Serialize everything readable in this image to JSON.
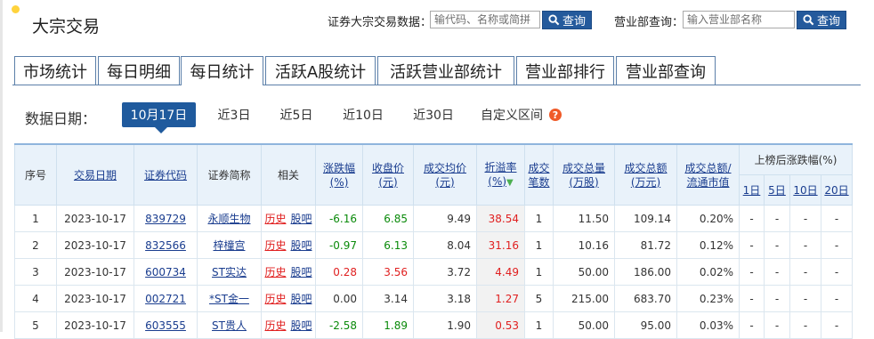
{
  "header": {
    "title": "大宗交易",
    "search_label": "证券大宗交易数据：",
    "search_placeholder": "输代码、名称或简拼",
    "search_button": "查询",
    "dept_label": "营业部查询：",
    "dept_placeholder": "输入营业部名称",
    "dept_button": "查询"
  },
  "tabs": [
    "市场统计",
    "每日明细",
    "每日统计",
    "活跃A股统计",
    "活跃营业部统计",
    "营业部排行",
    "营业部查询"
  ],
  "active_tab": "每日统计",
  "filter": {
    "label": "数据日期：",
    "periods": [
      "10月17日",
      "近3日",
      "近5日",
      "近10日",
      "近30日",
      "自定义区间"
    ],
    "active_period": "10月17日",
    "help_icon": "?"
  },
  "table": {
    "headers": {
      "seq": "序号",
      "date": "交易日期",
      "code": "证券代码",
      "name": "证券简称",
      "related": "相关",
      "change_1": "涨跌幅",
      "change_2": "(%)",
      "close_1": "收盘价",
      "close_2": "(元)",
      "avg_1": "成交均价",
      "avg_2": "(元)",
      "premium_1": "折溢率",
      "premium_2": "(%)",
      "count_1": "成交",
      "count_2": "笔数",
      "vol_1": "成交总量",
      "vol_2": "(万股)",
      "amount_1": "成交总额",
      "amount_2": "(万元)",
      "ratio_1": "成交总额/",
      "ratio_2": "流通市值",
      "after": "上榜后涨跌幅(%)",
      "d1": "1日",
      "d5": "5日",
      "d10": "10日",
      "d20": "20日"
    },
    "history_label": "历史",
    "bar_label": "股吧",
    "rows": [
      {
        "seq": "1",
        "date": "2023-10-17",
        "code": "839729",
        "name": "永顺生物",
        "change": "-6.16",
        "close": "6.85",
        "avg": "9.49",
        "premium": "38.54",
        "count": "1",
        "volume": "11.50",
        "amount": "109.14",
        "ratio": "0.20%",
        "d1": "-",
        "d5": "-",
        "d10": "-",
        "d20": "-",
        "dir": "neg"
      },
      {
        "seq": "2",
        "date": "2023-10-17",
        "code": "832566",
        "name": "梓橦宫",
        "change": "-0.97",
        "close": "6.13",
        "avg": "8.04",
        "premium": "31.16",
        "count": "1",
        "volume": "10.16",
        "amount": "81.72",
        "ratio": "0.12%",
        "d1": "-",
        "d5": "-",
        "d10": "-",
        "d20": "-",
        "dir": "neg"
      },
      {
        "seq": "3",
        "date": "2023-10-17",
        "code": "600734",
        "name": "ST实达",
        "change": "0.28",
        "close": "3.56",
        "avg": "3.72",
        "premium": "4.49",
        "count": "1",
        "volume": "50.00",
        "amount": "186.00",
        "ratio": "0.02%",
        "d1": "-",
        "d5": "-",
        "d10": "-",
        "d20": "-",
        "dir": "pos"
      },
      {
        "seq": "4",
        "date": "2023-10-17",
        "code": "002721",
        "name": "*ST金一",
        "change": "0.00",
        "close": "3.14",
        "avg": "3.18",
        "premium": "1.27",
        "count": "5",
        "volume": "215.00",
        "amount": "683.70",
        "ratio": "0.23%",
        "d1": "-",
        "d5": "-",
        "d10": "-",
        "d20": "-",
        "dir": "flat"
      },
      {
        "seq": "5",
        "date": "2023-10-17",
        "code": "603555",
        "name": "ST贵人",
        "change": "-2.58",
        "close": "1.89",
        "avg": "1.90",
        "premium": "0.53",
        "count": "1",
        "volume": "50.00",
        "amount": "95.00",
        "ratio": "0.03%",
        "d1": "-",
        "d5": "-",
        "d10": "-",
        "d20": "-",
        "dir": "neg"
      }
    ]
  }
}
